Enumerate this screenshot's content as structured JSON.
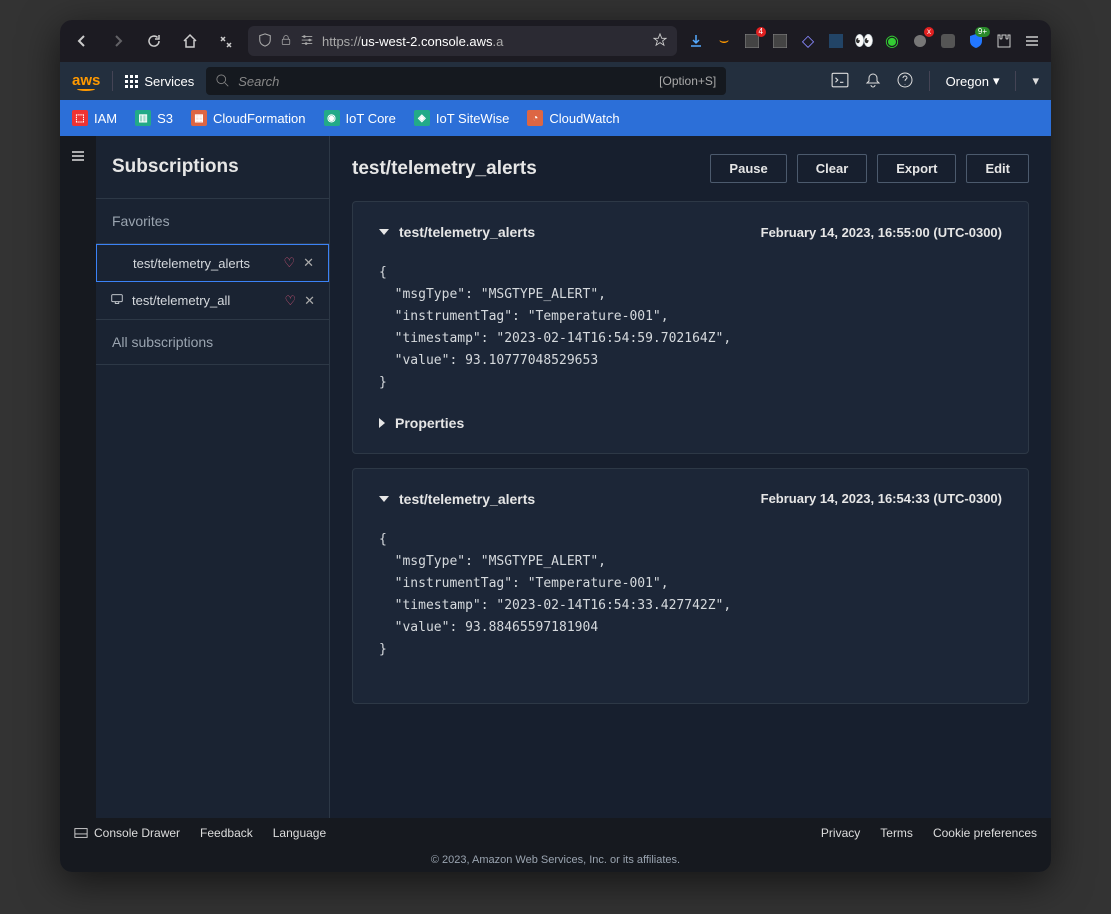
{
  "browser": {
    "url_prefix": "https://",
    "url_host": "us-west-2.console.aws",
    "url_suffix": ".a",
    "download_badge": "4",
    "ext_badge_x": "x",
    "ext_badge_9": "9+"
  },
  "aws": {
    "services": "Services",
    "search_placeholder": "Search",
    "search_shortcut": "[Option+S]",
    "region": "Oregon"
  },
  "favbar": {
    "iam": "IAM",
    "s3": "S3",
    "cf": "CloudFormation",
    "iot": "IoT Core",
    "sitewise": "IoT SiteWise",
    "cw": "CloudWatch"
  },
  "sidebar": {
    "title": "Subscriptions",
    "favorites": "Favorites",
    "items": [
      {
        "name": "test/telemetry_alerts"
      },
      {
        "name": "test/telemetry_all"
      }
    ],
    "all": "All subscriptions"
  },
  "content": {
    "title": "test/telemetry_alerts",
    "buttons": {
      "pause": "Pause",
      "clear": "Clear",
      "export": "Export",
      "edit": "Edit"
    },
    "properties": "Properties",
    "messages": [
      {
        "topic": "test/telemetry_alerts",
        "timestamp": "February 14, 2023, 16:55:00 (UTC-0300)",
        "body": "{\n  \"msgType\": \"MSGTYPE_ALERT\",\n  \"instrumentTag\": \"Temperature-001\",\n  \"timestamp\": \"2023-02-14T16:54:59.702164Z\",\n  \"value\": 93.10777048529653\n}"
      },
      {
        "topic": "test/telemetry_alerts",
        "timestamp": "February 14, 2023, 16:54:33 (UTC-0300)",
        "body": "{\n  \"msgType\": \"MSGTYPE_ALERT\",\n  \"instrumentTag\": \"Temperature-001\",\n  \"timestamp\": \"2023-02-14T16:54:33.427742Z\",\n  \"value\": 93.88465597181904\n}"
      }
    ]
  },
  "footer": {
    "drawer": "Console Drawer",
    "feedback": "Feedback",
    "language": "Language",
    "privacy": "Privacy",
    "terms": "Terms",
    "cookies": "Cookie preferences",
    "copyright": "© 2023, Amazon Web Services, Inc. or its affiliates."
  }
}
